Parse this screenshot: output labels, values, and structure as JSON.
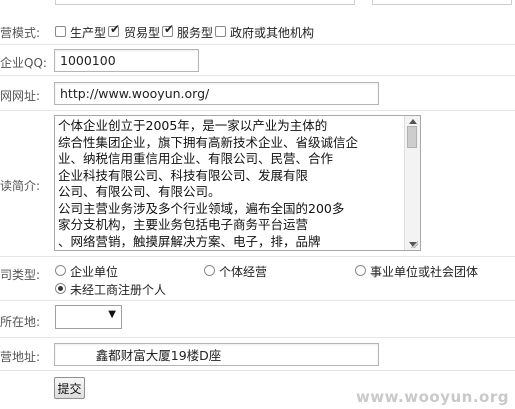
{
  "business_mode": {
    "label": "营模式:",
    "options": [
      {
        "label": "生产型",
        "checked": false
      },
      {
        "label": "贸易型",
        "checked": true
      },
      {
        "label": "服务型",
        "checked": true
      },
      {
        "label": "政府或其他机构",
        "checked": false
      }
    ]
  },
  "qq": {
    "label": "企业QQ:",
    "value": "1000100"
  },
  "website": {
    "label": "网网址:",
    "value": "http://www.wooyun.org/"
  },
  "intro": {
    "label": "读简介:",
    "lines": [
      "个体企业创立于2005年，是一家以产业为主体的",
      "综合性集团企业，旗下拥有高新技术企业、省级诚信企",
      "业、纳税信用重信用企业、有限公司、民营、合作",
      "企业科技有限公司、科技有限公司、发展有限",
      "公司、有限公司、有限公司。",
      "公司主营业务涉及多个行业领域，遍布全国的200多",
      "家分支机构，主要业务包括电子商务平台运营",
      "、网络营销，触摸屏解决方案、电子，排，品牌"
    ]
  },
  "company_type": {
    "label": "司类型:",
    "options": [
      {
        "label": "企业单位",
        "checked": false
      },
      {
        "label": "个体经营",
        "checked": false
      },
      {
        "label": "事业单位或社会团体",
        "checked": false
      },
      {
        "label": "未经工商注册个人",
        "checked": true
      }
    ]
  },
  "location": {
    "label": "所在地:",
    "value": "",
    "arrow": "▼"
  },
  "address": {
    "label": "营地址:",
    "value": "         鑫都财富大厦19楼D座"
  },
  "submit": {
    "label": "提交"
  },
  "watermark": "www.wooyun.org"
}
